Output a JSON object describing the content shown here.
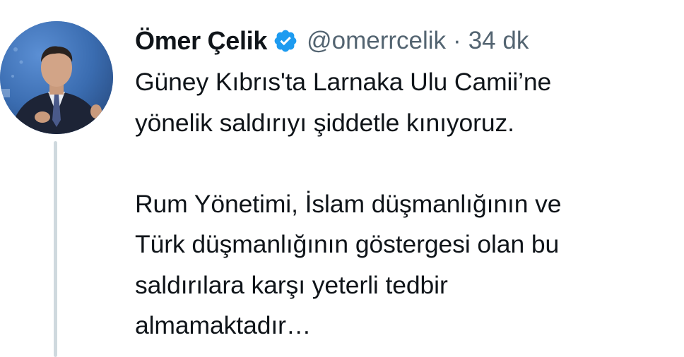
{
  "tweet": {
    "author": {
      "display_name": "Ömer Çelik",
      "handle": "@omerrcelik",
      "verified_icon": "verified-badge-icon",
      "avatar_icon": "profile-photo"
    },
    "separator": "·",
    "timestamp": "34 dk",
    "text": "Güney Kıbrıs'ta Larnaka Ulu Camii’ne\nyönelik saldırıyı şiddetle kınıyoruz.\n\nRum Yönetimi, İslam düşmanlığının ve\nTürk düşmanlığının göstergesi olan bu\nsaldırılara karşı yeterli tedbir\nalmamaktadır…"
  },
  "colors": {
    "text_primary": "#0f1419",
    "text_secondary": "#536471",
    "verified_blue": "#1d9bf0",
    "thread_line": "#cfd9de"
  }
}
